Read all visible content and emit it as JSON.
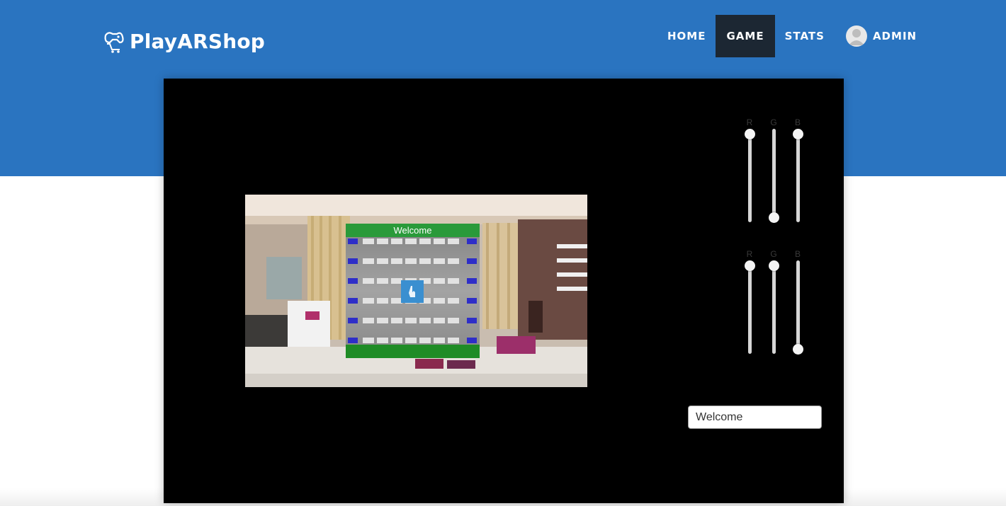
{
  "brand": {
    "name": "PlayARShop",
    "icon": "gamepad-cart-icon"
  },
  "nav": {
    "items": [
      {
        "label": "HOME",
        "active": false
      },
      {
        "label": "GAME",
        "active": true
      },
      {
        "label": "STATS",
        "active": false
      },
      {
        "label": "ADMIN",
        "active": false,
        "icon": "user-avatar-icon"
      }
    ]
  },
  "colors": {
    "header": "#2a74c0",
    "nav_active": "#1c2733",
    "canvas": "#000000",
    "panel_header": "#2a9a3a",
    "panel_footer": "#1f8c26"
  },
  "game": {
    "panel_title": "Welcome",
    "panel_icon": "hand-pointer-icon",
    "color_sliders": [
      {
        "group": "top",
        "channels": [
          {
            "label": "R",
            "level": 1.0
          },
          {
            "label": "G",
            "level": 0.0
          },
          {
            "label": "B",
            "level": 1.0
          }
        ]
      },
      {
        "group": "bottom",
        "channels": [
          {
            "label": "R",
            "level": 1.0
          },
          {
            "label": "G",
            "level": 1.0
          },
          {
            "label": "B",
            "level": 0.0
          }
        ]
      }
    ],
    "text_field": {
      "value": "Welcome"
    }
  }
}
